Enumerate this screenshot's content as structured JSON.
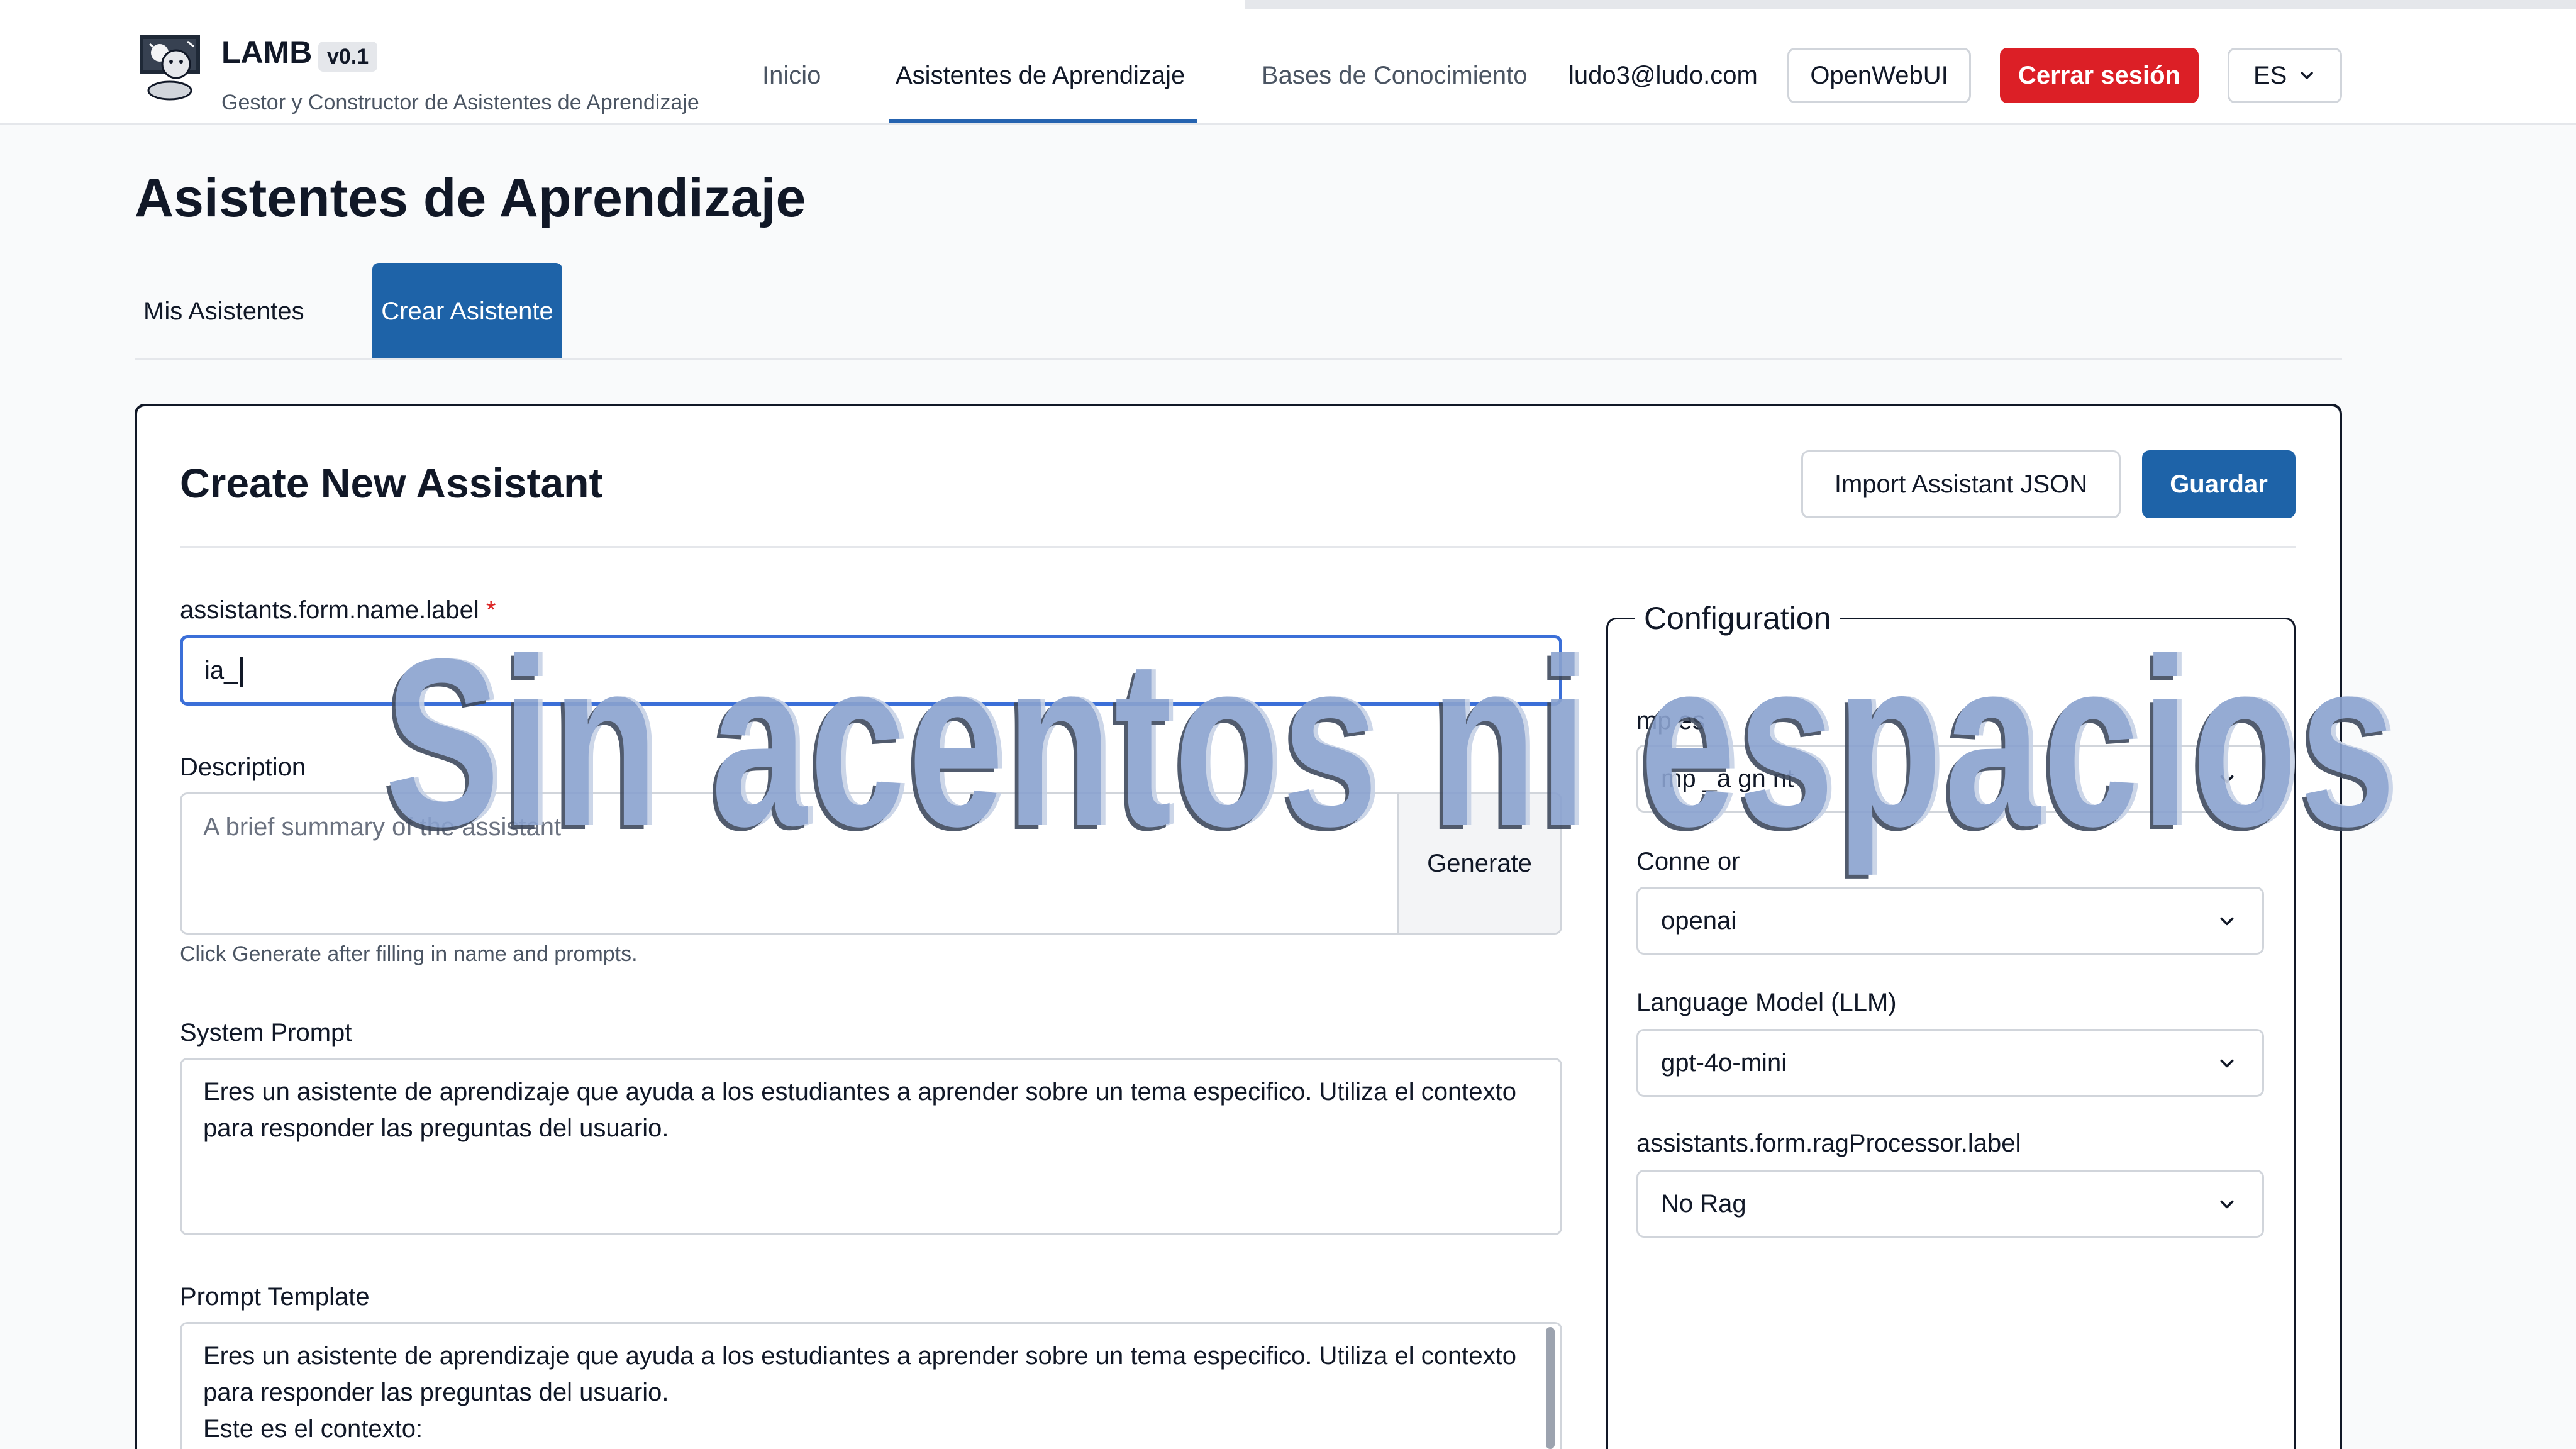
{
  "header": {
    "brand_name": "LAMB",
    "version": "v0.1",
    "subtitle": "Gestor y Constructor de Asistentes de Aprendizaje",
    "nav": [
      {
        "label": "Inicio",
        "active": false
      },
      {
        "label": "Asistentes de Aprendizaje",
        "active": true
      },
      {
        "label": "Bases de Conocimiento",
        "active": false
      }
    ],
    "user_email": "ludo3@ludo.com",
    "openwebui_label": "OpenWebUI",
    "logout_label": "Cerrar sesión",
    "language": "ES"
  },
  "page": {
    "title": "Asistentes de Aprendizaje",
    "tabs": [
      {
        "label": "Mis Asistentes",
        "active": false
      },
      {
        "label": "Crear Asistente",
        "active": true
      }
    ]
  },
  "form": {
    "title": "Create New Assistant",
    "import_label": "Import Assistant JSON",
    "save_label": "Guardar",
    "name_label": "assistants.form.name.label",
    "name_required_mark": "*",
    "name_value": "ia_",
    "description_label": "Description",
    "description_placeholder": "A brief summary of the assistant",
    "generate_label": "Generate",
    "generate_hint": "Click Generate after filling in name and prompts.",
    "system_prompt_label": "System Prompt",
    "system_prompt_value": "Eres un asistente de aprendizaje que ayuda a los estudiantes a aprender sobre un tema especifico. Utiliza el contexto para responder las preguntas del usuario.",
    "prompt_template_label": "Prompt Template",
    "prompt_template_value": "Eres un asistente de aprendizaje que ayuda a los estudiantes a aprender sobre un tema especifico. Utiliza el contexto para responder las preguntas del usuario.\nEste es el contexto:"
  },
  "config": {
    "legend": "Configuration",
    "template_label": "mp es",
    "template_value": "mp _a gn nt",
    "connector_label": "Conne or",
    "connector_value": "openai",
    "llm_label": "Language Model (LLM)",
    "llm_value": "gpt-4o-mini",
    "rag_label": "assistants.form.ragProcessor.label",
    "rag_value": "No Rag"
  },
  "overlay": {
    "caption": "Sin acentos ni espacios"
  },
  "colors": {
    "primary": "#1e63a8",
    "danger": "#dc1f26",
    "focus": "#3b6fd8"
  },
  "icons": [
    "lamb-logo-icon",
    "chevron-down-icon"
  ]
}
